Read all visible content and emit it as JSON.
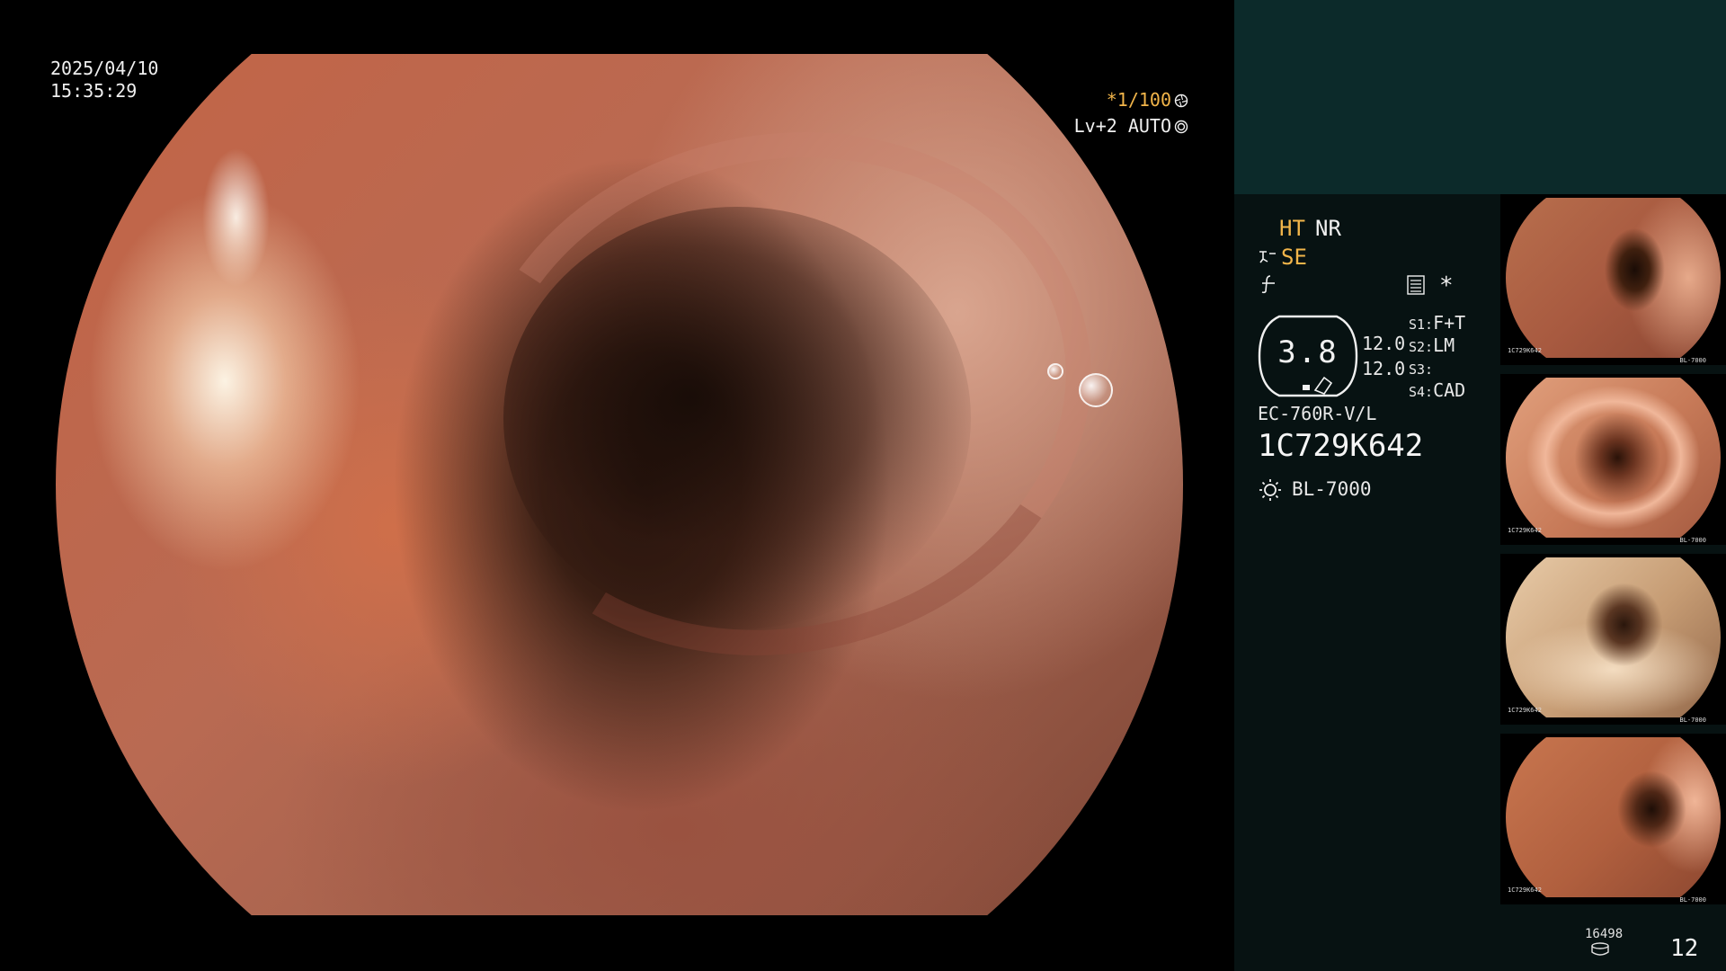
{
  "overlay": {
    "date": "2025/04/10",
    "time": "15:35:29",
    "shutter": "*1/100",
    "level": "Lv+2 AUTO"
  },
  "panel": {
    "ht": "HT",
    "nr": "NR",
    "se": "SE",
    "star": "*",
    "zoom_value": "3.8",
    "value_1": "12.0",
    "value_2": "12.0",
    "s1_key": "S1:",
    "s1_value": "F+T",
    "s2_key": "S2:",
    "s2_value": "LM",
    "s3_key": "S3:",
    "s3_value": "",
    "s4_key": "S4:",
    "s4_value": "CAD",
    "scope_model": "EC-760R-V/L",
    "scope_serial": "1C729K642",
    "light_source": "BL-7000"
  },
  "thumbnails": [
    {
      "serial": "1C729K642",
      "lamp": "BL-7000"
    },
    {
      "serial": "1C729K642",
      "lamp": "BL-7000"
    },
    {
      "serial": "1C729K642",
      "lamp": "BL-7000"
    },
    {
      "serial": "1C729K642",
      "lamp": "BL-7000"
    }
  ],
  "footer": {
    "storage_count": "16498",
    "image_count": "12"
  },
  "colors": {
    "accent_orange": "#f2b54a",
    "panel_bg": "#071212",
    "panel_top_bg": "#0c2a2a"
  },
  "icons": {
    "shutter": "aperture-icon",
    "level": "auto-iris-icon",
    "se": "structure-enhance-icon",
    "nf": "no-filter-icon",
    "menu": "settings-list-icon",
    "light": "sun-icon",
    "storage": "storage-drive-icon"
  }
}
